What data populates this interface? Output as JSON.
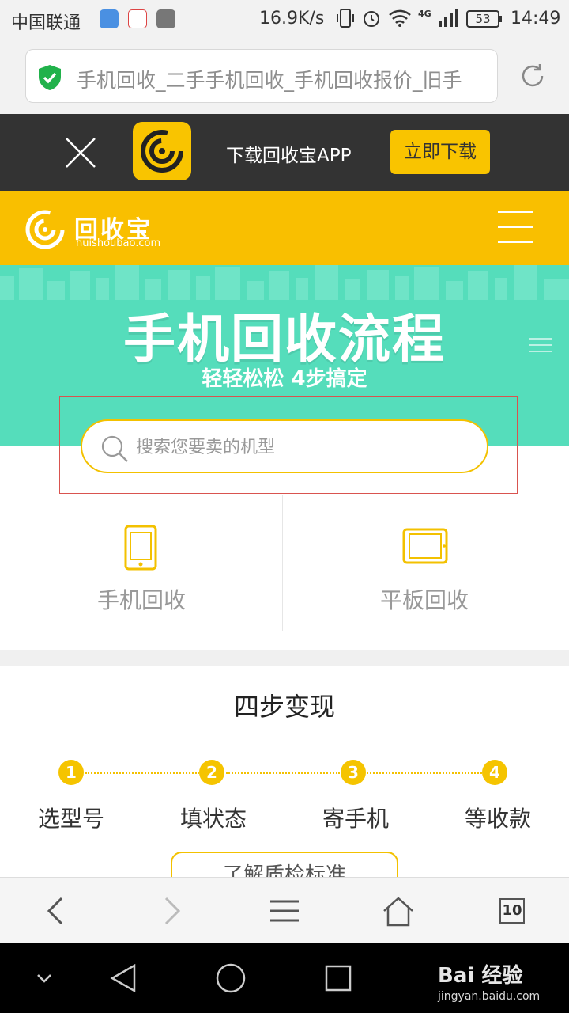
{
  "status_bar": {
    "carrier": "中国联通",
    "net_speed": "16.9K/s",
    "network": "4G",
    "battery": "53",
    "time": "14:49"
  },
  "address_bar": {
    "url_title": "手机回收_二手手机回收_手机回收报价_旧手"
  },
  "download_banner": {
    "text": "下载回收宝APP",
    "button": "立即下载"
  },
  "site_header": {
    "brand": "回收宝",
    "domain": "huishoubao.com"
  },
  "hero": {
    "title": "手机回收流程",
    "subtitle": "轻轻松松  4步搞定"
  },
  "search": {
    "placeholder": "搜索您要卖的机型"
  },
  "categories": [
    {
      "label": "手机回收",
      "icon": "phone-icon"
    },
    {
      "label": "平板回收",
      "icon": "tablet-icon"
    }
  ],
  "steps": {
    "title": "四步变现",
    "items": [
      {
        "num": "1",
        "label": "选型号"
      },
      {
        "num": "2",
        "label": "填状态"
      },
      {
        "num": "3",
        "label": "寄手机"
      },
      {
        "num": "4",
        "label": "等收款"
      }
    ],
    "standard_button": "了解质检标准"
  },
  "browser_bar": {
    "tab_count": "10"
  },
  "watermark": {
    "main": "Bai 经验",
    "sub": "jingyan.baidu.com"
  },
  "colors": {
    "brand_yellow": "#f9bf00",
    "hero_green": "#55ddbb",
    "banner_dark": "#333333"
  }
}
